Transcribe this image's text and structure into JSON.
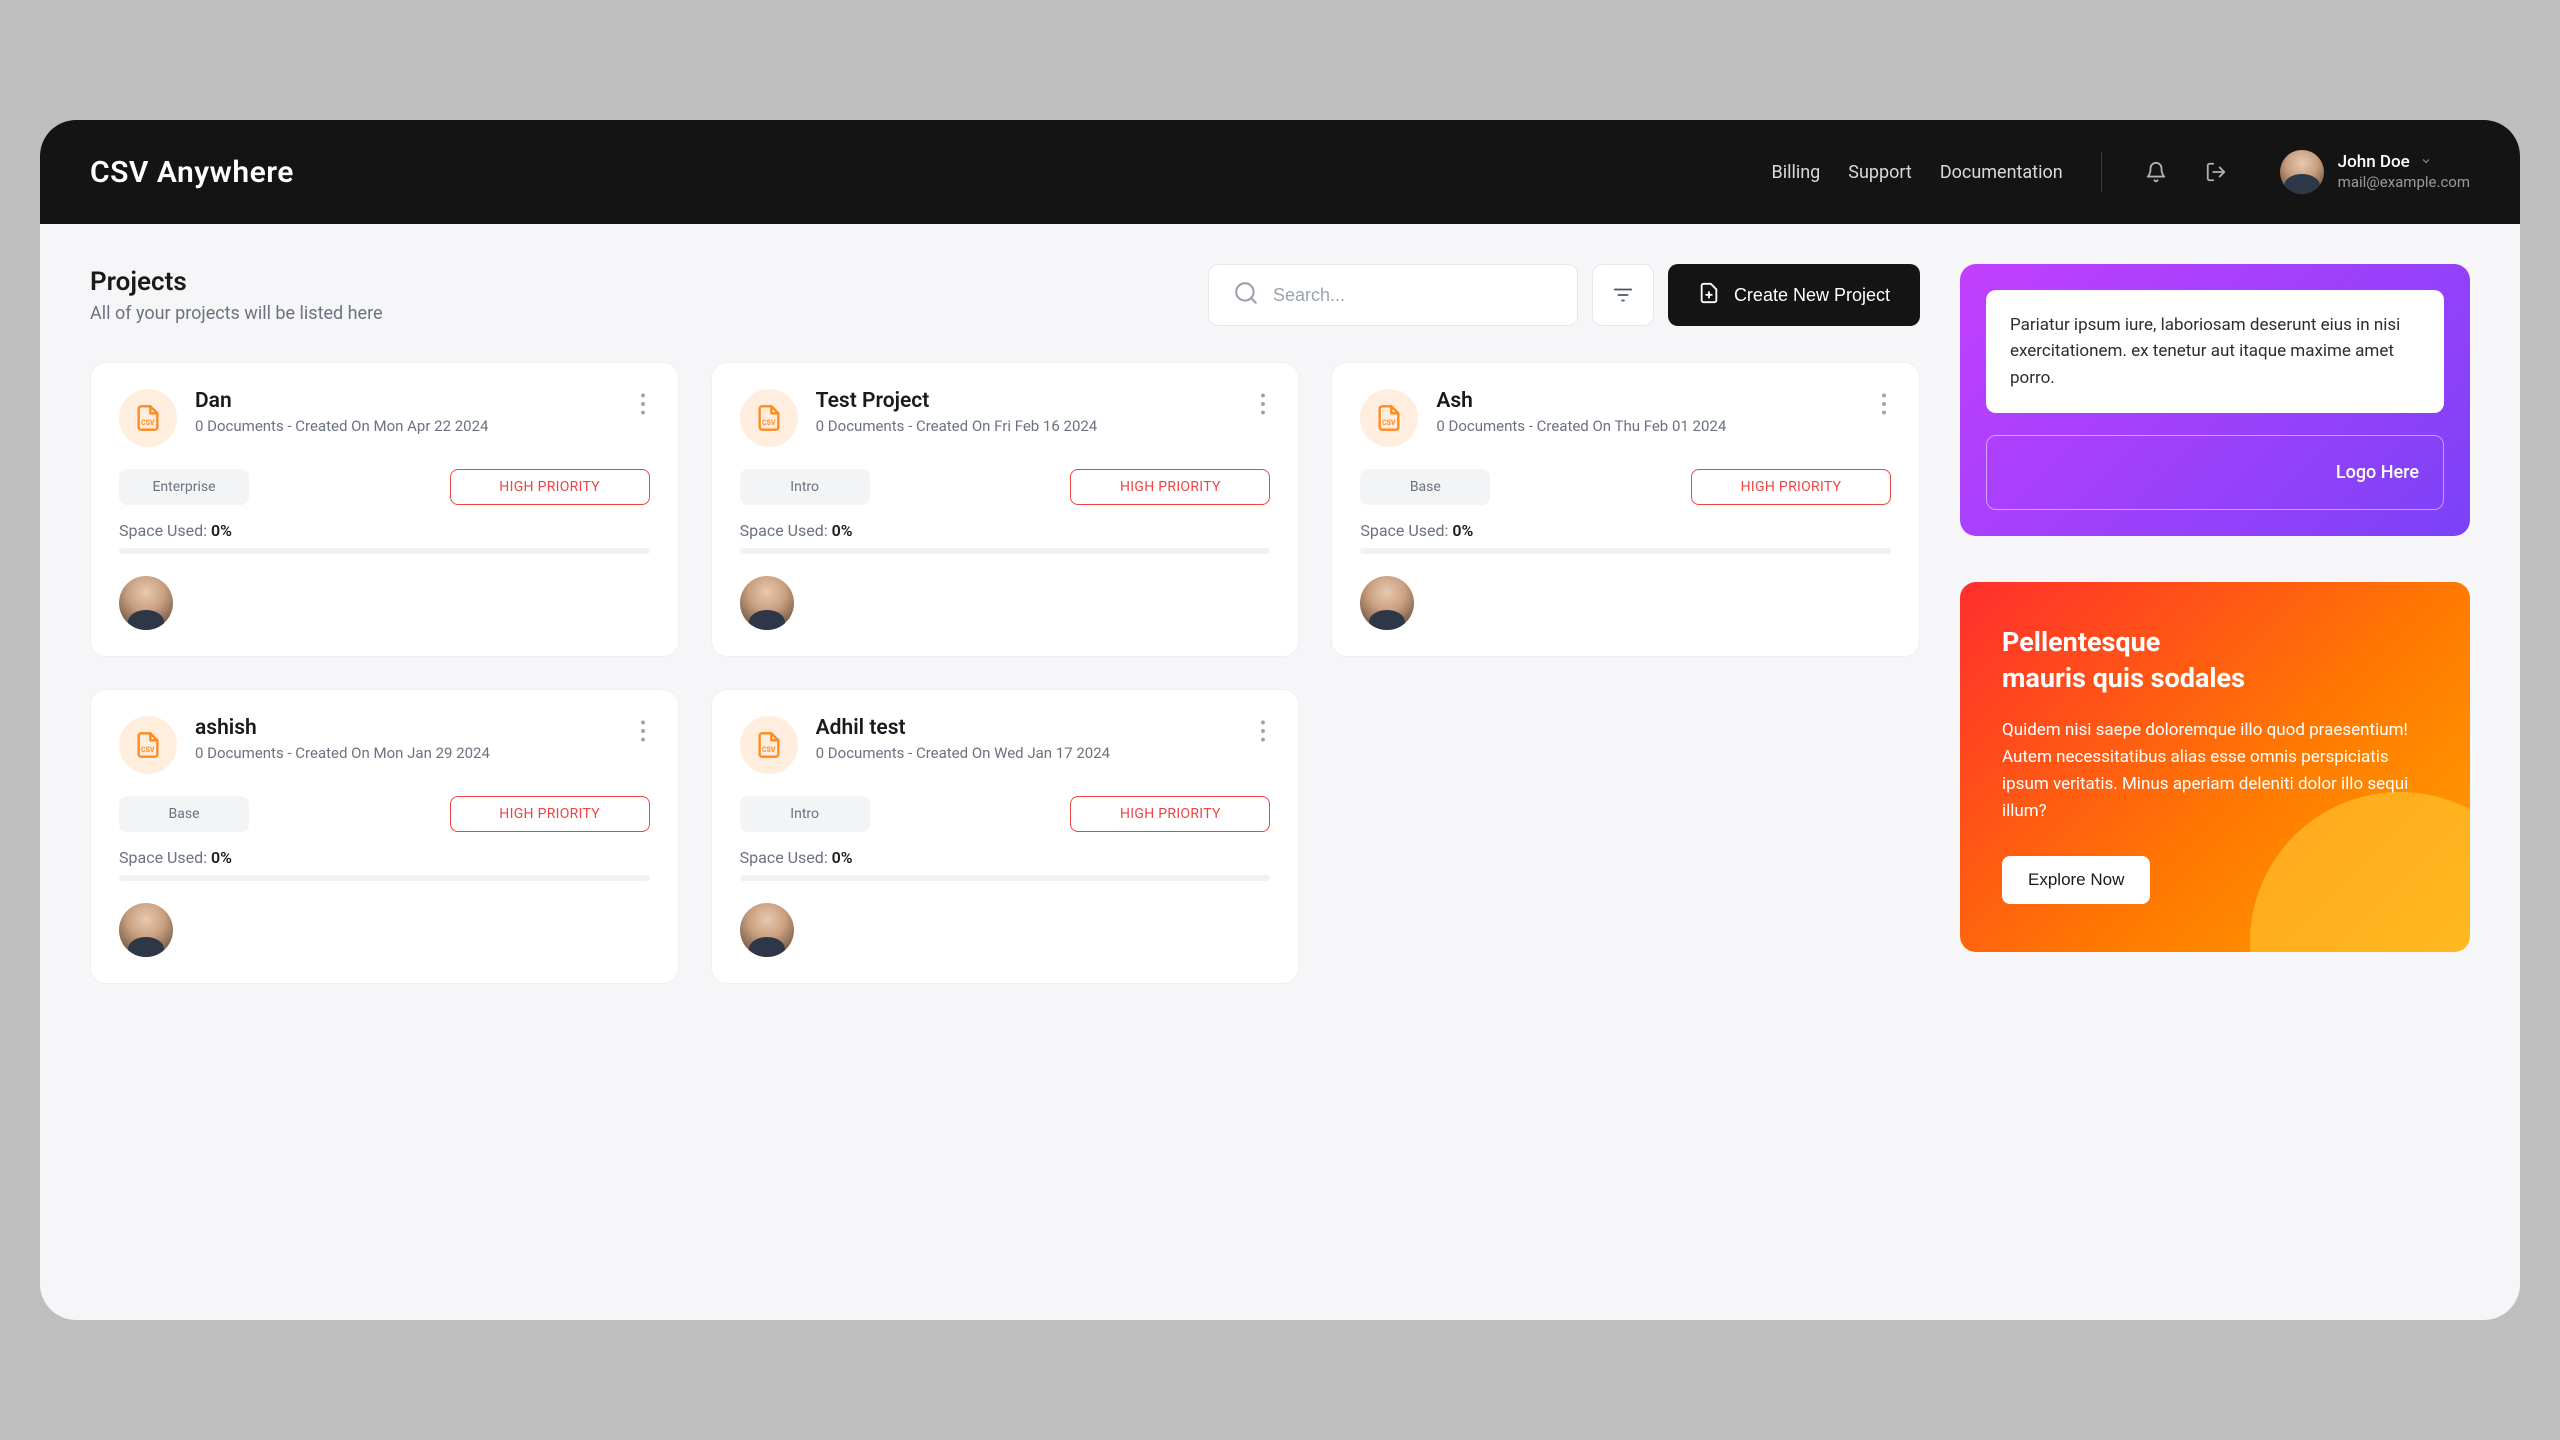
{
  "header": {
    "brand": "CSV Anywhere",
    "nav": {
      "billing": "Billing",
      "support": "Support",
      "documentation": "Documentation"
    },
    "user": {
      "name": "John Doe",
      "email": "mail@example.com"
    }
  },
  "page": {
    "title": "Projects",
    "subtitle": "All of your projects will be listed here",
    "search_placeholder": "Search...",
    "create_label": "Create New Project"
  },
  "projects": [
    {
      "name": "Dan",
      "documents": 0,
      "created": "Mon Apr 22 2024",
      "plan": "Enterprise",
      "priority": "HIGH PRIORITY",
      "space_used": "0%"
    },
    {
      "name": "Test Project",
      "documents": 0,
      "created": "Fri Feb 16 2024",
      "plan": "Intro",
      "priority": "HIGH PRIORITY",
      "space_used": "0%"
    },
    {
      "name": "Ash",
      "documents": 0,
      "created": "Thu Feb 01 2024",
      "plan": "Base",
      "priority": "HIGH PRIORITY",
      "space_used": "0%"
    },
    {
      "name": "ashish",
      "documents": 0,
      "created": "Mon Jan 29 2024",
      "plan": "Base",
      "priority": "HIGH PRIORITY",
      "space_used": "0%"
    },
    {
      "name": "Adhil test",
      "documents": 0,
      "created": "Wed Jan 17 2024",
      "plan": "Intro",
      "priority": "HIGH PRIORITY",
      "space_used": "0%"
    }
  ],
  "labels": {
    "space_used": "Space Used:",
    "docs_prefix": "Documents - Created On"
  },
  "promo1": {
    "text": "Pariatur ipsum iure, laboriosam deserunt eius in nisi exercitationem. ex tenetur aut itaque maxime amet porro.",
    "logo": "Logo Here"
  },
  "promo2": {
    "title_line1": "Pellentesque",
    "title_line2": "mauris quis sodales",
    "body": "Quidem nisi saepe doloremque illo quod praesentium! Autem necessitatibus alias esse omnis perspiciatis ipsum veritatis. Minus aperiam deleniti dolor illo sequi illum?",
    "button": "Explore Now"
  }
}
